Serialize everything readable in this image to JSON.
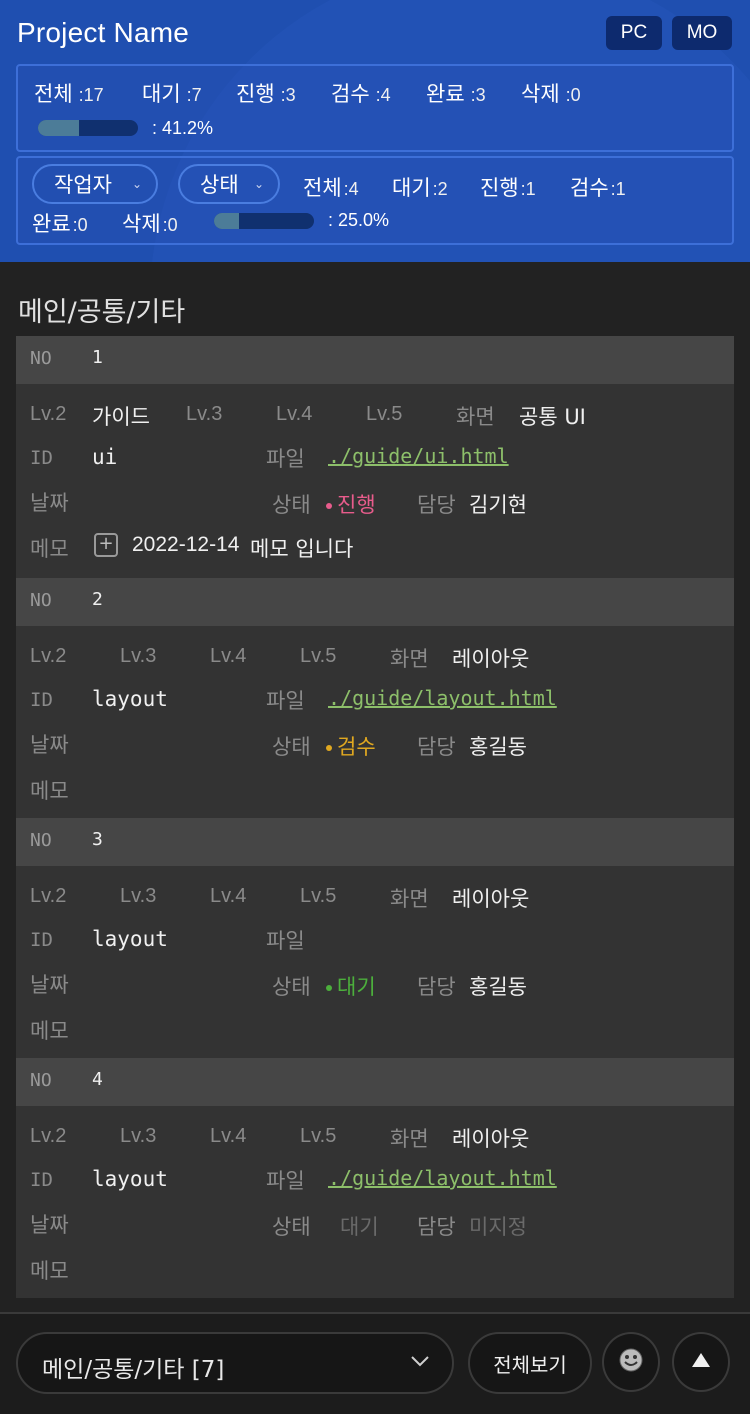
{
  "header": {
    "title": "Project Name",
    "mode_pc": "PC",
    "mode_mo": "MO"
  },
  "summary": {
    "stats": [
      {
        "label": "전체",
        "value": ":17"
      },
      {
        "label": "대기",
        "value": ":7"
      },
      {
        "label": "진행",
        "value": ":3"
      },
      {
        "label": "검수",
        "value": ":4"
      },
      {
        "label": "완료",
        "value": ":3"
      },
      {
        "label": "삭제",
        "value": ":0"
      }
    ],
    "progress": 0.412,
    "progress_text": ": 41.2%"
  },
  "filter": {
    "worker_label": "작업자",
    "status_label": "상태",
    "stats": [
      {
        "label": "전체",
        "value": ":4"
      },
      {
        "label": "대기",
        "value": ":2"
      },
      {
        "label": "진행",
        "value": ":1"
      },
      {
        "label": "검수",
        "value": ":1"
      },
      {
        "label": "완료",
        "value": ":0"
      },
      {
        "label": "삭제",
        "value": ":0"
      }
    ],
    "progress": 0.25,
    "progress_text": ": 25.0%"
  },
  "section_title": "메인/공통/기타",
  "labels": {
    "no": "NO",
    "lv2": "Lv.2",
    "lv3": "Lv.3",
    "lv4": "Lv.4",
    "lv5": "Lv.5",
    "screen": "화면",
    "id": "ID",
    "file": "파일",
    "date": "날짜",
    "status": "상태",
    "owner": "담당",
    "memo": "메모"
  },
  "items": [
    {
      "no": "1",
      "lv2": "가이드",
      "screen": "공통 UI",
      "id": "ui",
      "file": "./guide/ui.html",
      "status": "진행",
      "status_color": "#e85c8c",
      "owner": "김기현",
      "memo_date": "2022-12-14",
      "memo_text": "메모 입니다"
    },
    {
      "no": "2",
      "lv2": "",
      "screen": "레이아웃",
      "id": "layout",
      "file": "./guide/layout.html",
      "status": "검수",
      "status_color": "#e0a820",
      "owner": "홍길동",
      "memo_date": "",
      "memo_text": ""
    },
    {
      "no": "3",
      "lv2": "",
      "screen": "레이아웃",
      "id": "layout",
      "file": "",
      "status": "대기",
      "status_color": "#4caf3c",
      "owner": "홍길동",
      "memo_date": "",
      "memo_text": ""
    },
    {
      "no": "4",
      "lv2": "",
      "screen": "레이아웃",
      "id": "layout",
      "file": "./guide/layout.html",
      "status": "대기",
      "status_color": "#6a6a6a",
      "owner": "미지정",
      "memo_date": "",
      "memo_text": ""
    }
  ],
  "bottom": {
    "select_text": "메인/공통/기타 [7]",
    "view_all": "전체보기",
    "face_icon": "smiley-icon",
    "top_icon": "scroll-top-icon"
  }
}
